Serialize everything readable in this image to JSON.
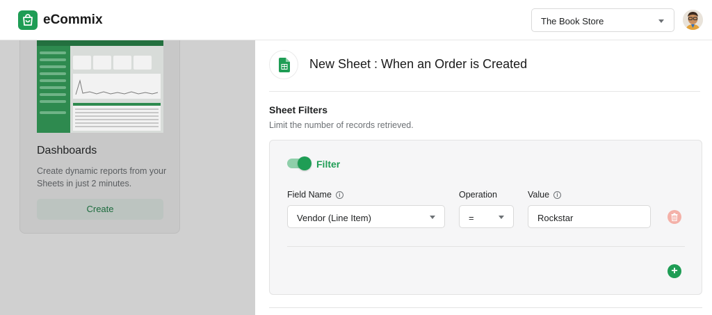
{
  "header": {
    "brand": "eCommix",
    "store_select": "The Book Store"
  },
  "sidebar_card": {
    "title": "Dashboards",
    "description": "Create dynamic reports from your Sheets in just 2 minutes.",
    "create_label": "Create"
  },
  "sheet": {
    "title": "New Sheet : When an Order is Created"
  },
  "filters": {
    "section_title": "Sheet Filters",
    "section_subtitle": "Limit the number of records retrieved.",
    "toggle_label": "Filter",
    "toggle_on": true,
    "field_name_label": "Field Name",
    "operation_label": "Operation",
    "value_label": "Value",
    "field_name_value": "Vendor (Line Item)",
    "operation_value": "=",
    "value_value": "Rockstar",
    "info_glyph": "i"
  },
  "colors": {
    "accent": "#1f9d55",
    "delete": "#f4b1a8"
  },
  "icons": [
    "shopping-bag-icon",
    "chevron-down-icon",
    "avatar",
    "google-sheets-icon",
    "info-icon",
    "trash-icon",
    "plus-icon"
  ]
}
